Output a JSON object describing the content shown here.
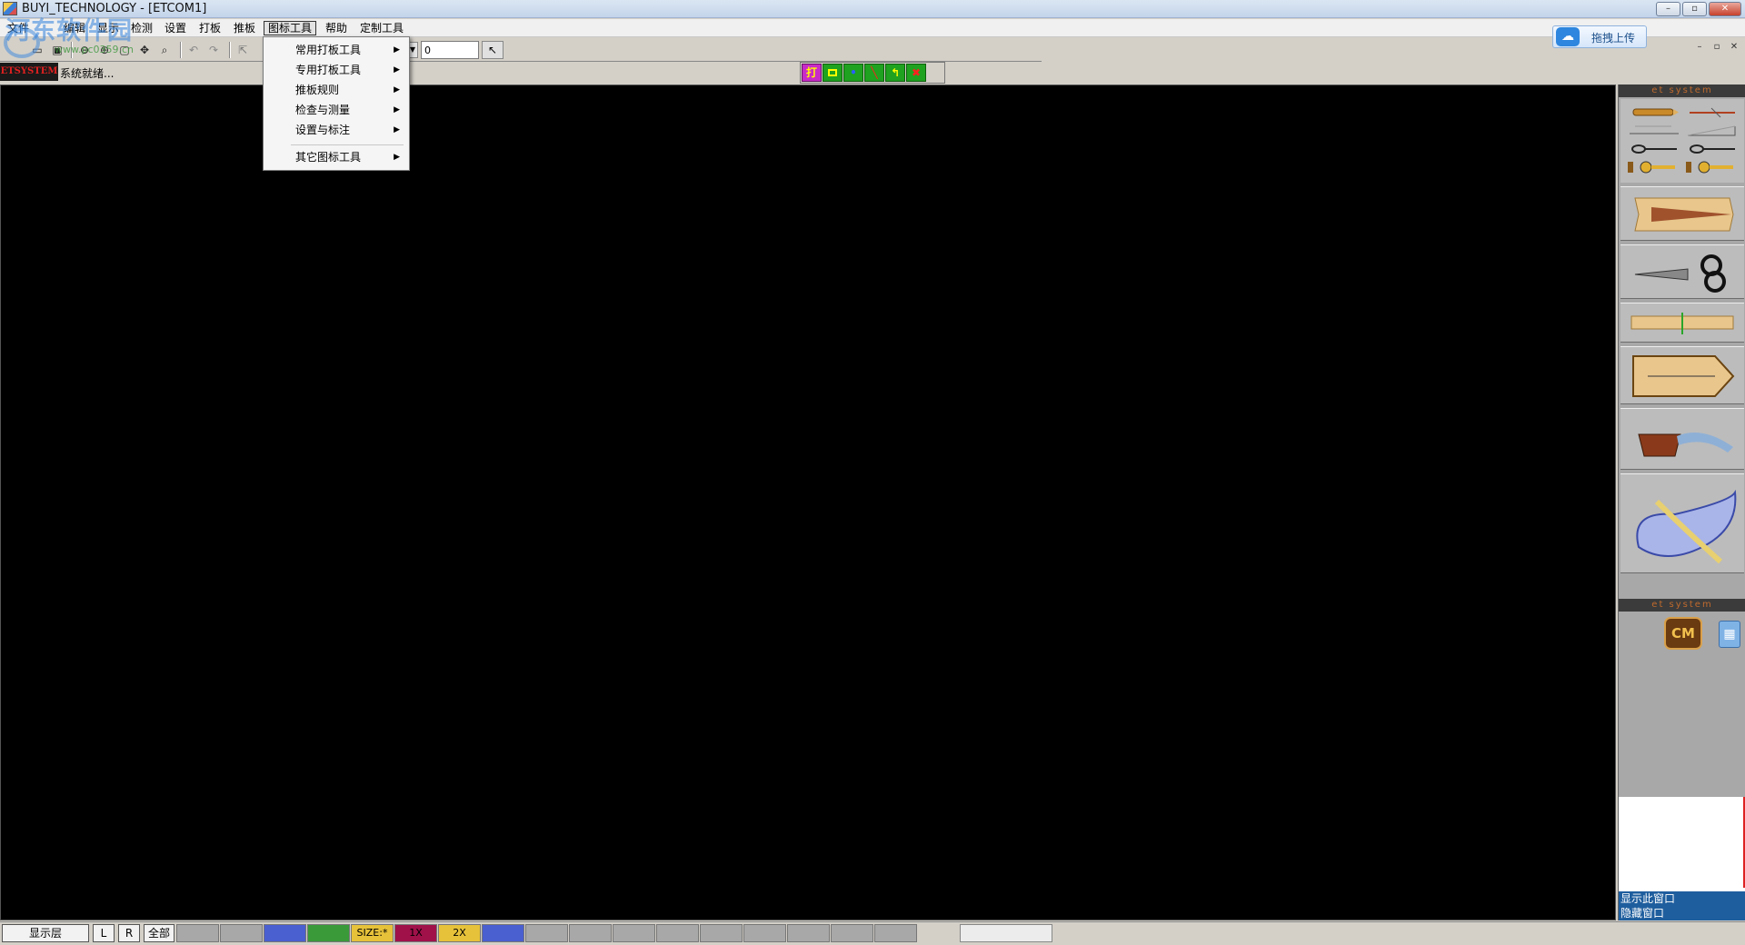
{
  "window": {
    "title": "BUYI_TECHNOLOGY - [ETCOM1]",
    "min": "–",
    "max": "▫",
    "close": "✕"
  },
  "watermark": {
    "text": "河东软件园",
    "url": "www.pc0359.cn"
  },
  "menus": [
    "文件",
    "编辑",
    "显示",
    "检测",
    "设置",
    "打板",
    "推板",
    "图标工具",
    "帮助",
    "定制工具"
  ],
  "mdi": {
    "min": "–",
    "restore": "▫",
    "close": "✕"
  },
  "upload": {
    "label": "拖拽上传",
    "icon": "cloud-icon"
  },
  "toolbar": {
    "value_input": "0",
    "icons": [
      "open-icon",
      "save-icon",
      "zoom-out-icon",
      "zoom-in-icon",
      "fit-icon",
      "pan-icon",
      "zoom-window-icon",
      "undo-icon",
      "redo-icon",
      "select-icon",
      "pointer-icon"
    ]
  },
  "status": {
    "brand": "ETSYSTEM",
    "text": "系统就绪..."
  },
  "mode_strip": {
    "print_label": "打"
  },
  "dropdown": {
    "items": [
      {
        "label": "常用打板工具",
        "arrow": "▶"
      },
      {
        "label": "专用打板工具",
        "arrow": "▶"
      },
      {
        "label": "推板规则",
        "arrow": "▶"
      },
      {
        "label": "检查与测量",
        "arrow": "▶"
      },
      {
        "label": "设置与标注",
        "arrow": "▶"
      },
      {
        "label": "其它图标工具",
        "arrow": "▶"
      }
    ]
  },
  "right_panel": {
    "header_top": "et system",
    "header_bottom": "et system",
    "cm_label": "CM",
    "show_window": "显示此窗口",
    "show_window_2": "隐藏窗口"
  },
  "bottom": {
    "layer_label": "显示层",
    "l": "L",
    "r": "R",
    "all": "全部",
    "swatches": [
      {
        "label": "",
        "color": "#a8a8a8"
      },
      {
        "label": "",
        "color": "#a8a8a8"
      },
      {
        "label": "",
        "color": "#4a5fd0"
      },
      {
        "label": "",
        "color": "#3a9a3a"
      },
      {
        "label": "SIZE:*",
        "color": "#e6c23a"
      },
      {
        "label": "1X",
        "color": "#a0114a"
      },
      {
        "label": "2X",
        "color": "#e6c23a"
      },
      {
        "label": "",
        "color": "#4a5fd0"
      },
      {
        "label": "",
        "color": "#a8a8a8"
      },
      {
        "label": "",
        "color": "#a8a8a8"
      },
      {
        "label": "",
        "color": "#a8a8a8"
      },
      {
        "label": "",
        "color": "#a8a8a8"
      },
      {
        "label": "",
        "color": "#a8a8a8"
      },
      {
        "label": "",
        "color": "#a8a8a8"
      },
      {
        "label": "",
        "color": "#a8a8a8"
      },
      {
        "label": "",
        "color": "#a8a8a8"
      },
      {
        "label": "",
        "color": "#a8a8a8"
      }
    ]
  }
}
